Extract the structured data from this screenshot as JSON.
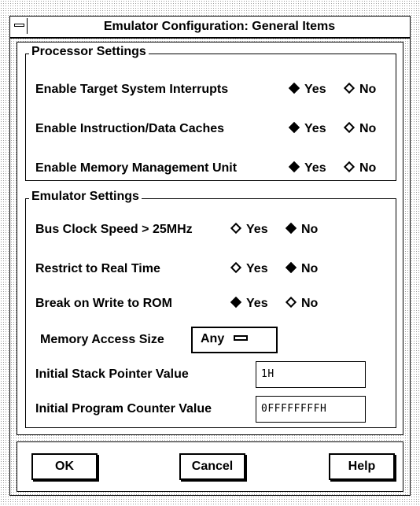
{
  "window": {
    "title": "Emulator Configuration: General Items"
  },
  "processor": {
    "title": "Processor Settings",
    "rows": [
      {
        "label": "Enable Target System Interrupts",
        "yes": "Yes",
        "no": "No",
        "selected": "Yes"
      },
      {
        "label": "Enable Instruction/Data Caches",
        "yes": "Yes",
        "no": "No",
        "selected": "Yes"
      },
      {
        "label": "Enable Memory Management Unit",
        "yes": "Yes",
        "no": "No",
        "selected": "Yes"
      }
    ]
  },
  "emulator": {
    "title": "Emulator Settings",
    "rows": [
      {
        "label": "Bus Clock Speed > 25MHz",
        "yes": "Yes",
        "no": "No",
        "selected": "No"
      },
      {
        "label": "Restrict to Real Time",
        "yes": "Yes",
        "no": "No",
        "selected": "No"
      },
      {
        "label": "Break on Write to ROM",
        "yes": "Yes",
        "no": "No",
        "selected": "Yes"
      }
    ],
    "memory_access": {
      "label": "Memory Access Size",
      "value": "Any"
    },
    "stack_pointer": {
      "label": "Initial Stack Pointer Value",
      "value": "1H"
    },
    "program_counter": {
      "label": "Initial Program Counter Value",
      "value": "0FFFFFFFFH"
    }
  },
  "buttons": {
    "ok": "OK",
    "cancel": "Cancel",
    "help": "Help"
  }
}
